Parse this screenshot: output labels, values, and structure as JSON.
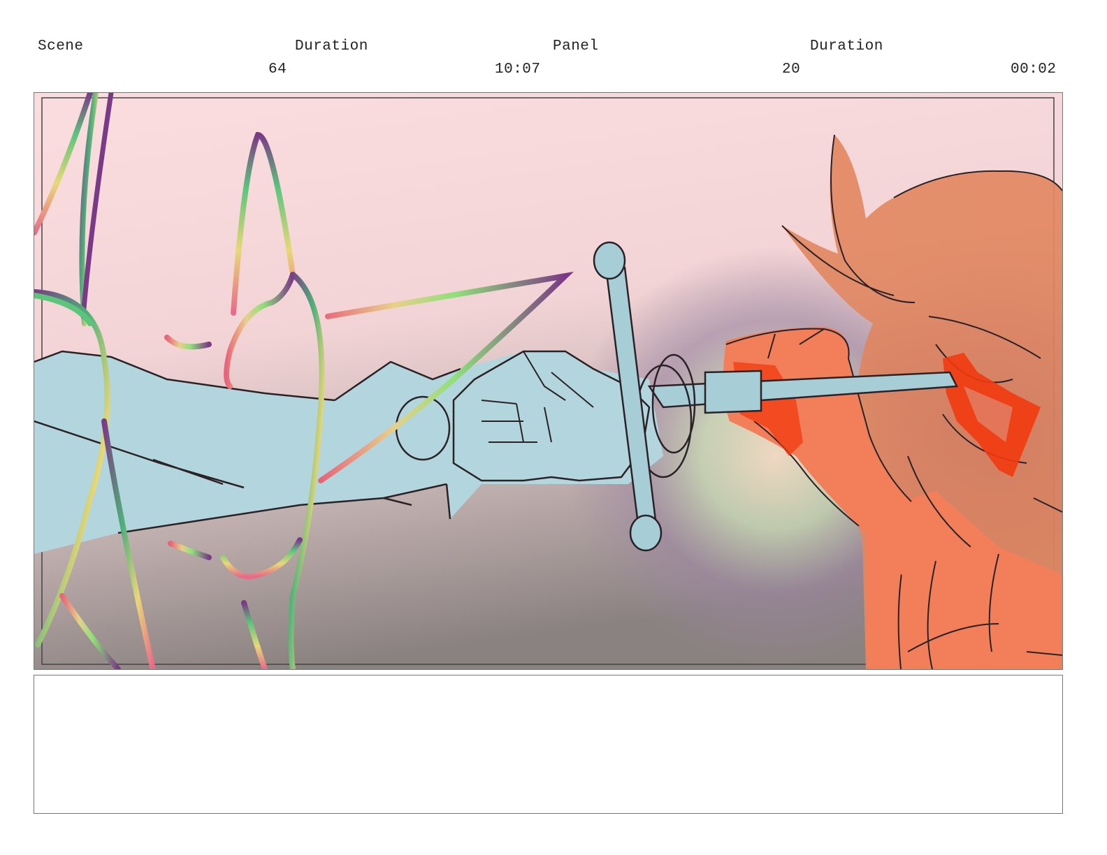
{
  "header": {
    "scene_label": "Scene",
    "scene_duration_label": "Duration",
    "panel_label": "Panel",
    "panel_duration_label": "Duration",
    "scene_value": "64",
    "scene_duration_value": "10:07",
    "panel_value": "20",
    "panel_duration_value": "00:02"
  },
  "colors": {
    "sky_top": "#fbdde0",
    "ground": "#8a8280",
    "blue_figure": "#b3d5dd",
    "orange_figure": "#f0845e",
    "red_accent": "#f23a10",
    "line": "#2a2226"
  },
  "notes": {
    "text": ""
  }
}
